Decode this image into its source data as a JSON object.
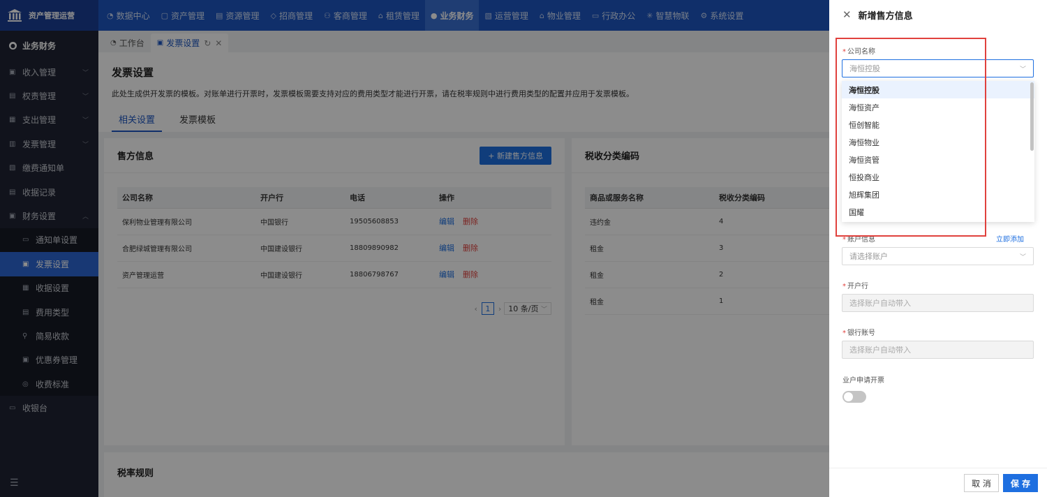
{
  "app": {
    "title": "资产管理运营"
  },
  "topnav": [
    {
      "label": "数据中心",
      "icon": "dashboard-icon"
    },
    {
      "label": "资产管理",
      "icon": "cube-icon"
    },
    {
      "label": "资源管理",
      "icon": "building-icon"
    },
    {
      "label": "招商管理",
      "icon": "diamond-icon"
    },
    {
      "label": "客商管理",
      "icon": "users-icon"
    },
    {
      "label": "租赁管理",
      "icon": "house-icon"
    },
    {
      "label": "业务财务",
      "icon": "finance-icon"
    },
    {
      "label": "运营管理",
      "icon": "chart-icon"
    },
    {
      "label": "物业管理",
      "icon": "home-icon"
    },
    {
      "label": "行政办公",
      "icon": "monitor-icon"
    },
    {
      "label": "智慧物联",
      "icon": "iot-icon"
    },
    {
      "label": "系统设置",
      "icon": "gear-icon"
    }
  ],
  "sidebar": {
    "head": "业务财务",
    "items": [
      {
        "label": "收入管理"
      },
      {
        "label": "权责管理"
      },
      {
        "label": "支出管理"
      },
      {
        "label": "发票管理"
      },
      {
        "label": "缴费通知单"
      },
      {
        "label": "收据记录"
      },
      {
        "label": "财务设置"
      }
    ],
    "subitems": [
      {
        "label": "通知单设置"
      },
      {
        "label": "发票设置"
      },
      {
        "label": "收据设置"
      },
      {
        "label": "费用类型"
      },
      {
        "label": "简易收款"
      },
      {
        "label": "优惠券管理"
      },
      {
        "label": "收费标准"
      }
    ],
    "last": "收银台"
  },
  "page_tabs": [
    {
      "label": "工作台"
    },
    {
      "label": "发票设置"
    }
  ],
  "page": {
    "title": "发票设置",
    "desc": "此处生成供开发票的模板。对账单进行开票时，发票模板需要支持对应的费用类型才能进行开票，请在税率规则中进行费用类型的配置并应用于发票模板。",
    "sub_tabs": [
      "相关设置",
      "发票模板"
    ]
  },
  "seller": {
    "title": "售方信息",
    "new_button": "+  新建售方信息",
    "columns": [
      "公司名称",
      "开户行",
      "电话",
      "操作"
    ],
    "rows": [
      {
        "company": "保利物业管理有限公司",
        "bank": "中国银行",
        "phone": "19505608853"
      },
      {
        "company": "合肥绿城管理有限公司",
        "bank": "中国建设银行",
        "phone": "18809890982"
      },
      {
        "company": "资产管理运营",
        "bank": "中国建设银行",
        "phone": "18806798767"
      }
    ],
    "edit_label": "编辑",
    "delete_label": "删除",
    "pager_page": "1",
    "pager_size": "10 条/页"
  },
  "tax": {
    "title": "税收分类编码",
    "columns": [
      "商品或服务名称",
      "税收分类编码"
    ],
    "rows": [
      {
        "name": "违约金",
        "code": "4"
      },
      {
        "name": "租金",
        "code": "3"
      },
      {
        "name": "租金",
        "code": "2"
      },
      {
        "name": "租金",
        "code": "1"
      }
    ]
  },
  "tax_rule": {
    "title": "税率规则"
  },
  "drawer": {
    "title": "新增售方信息",
    "company_label": "公司名称",
    "company_value": "海恒控股",
    "options": [
      "海恒控股",
      "海恒资产",
      "恒创智能",
      "海恒物业",
      "海恒资管",
      "恒投商业",
      "旭辉集团",
      "国耀"
    ],
    "account_label": "账户信息",
    "add_link": "立即添加",
    "account_placeholder": "请选择账户",
    "bank_label": "开户行",
    "bank_placeholder": "选择账户自动带入",
    "bankno_label": "银行账号",
    "bankno_placeholder": "选择账户自动带入",
    "apply_label": "业户申请开票",
    "cancel": "取 消",
    "save": "保 存"
  }
}
